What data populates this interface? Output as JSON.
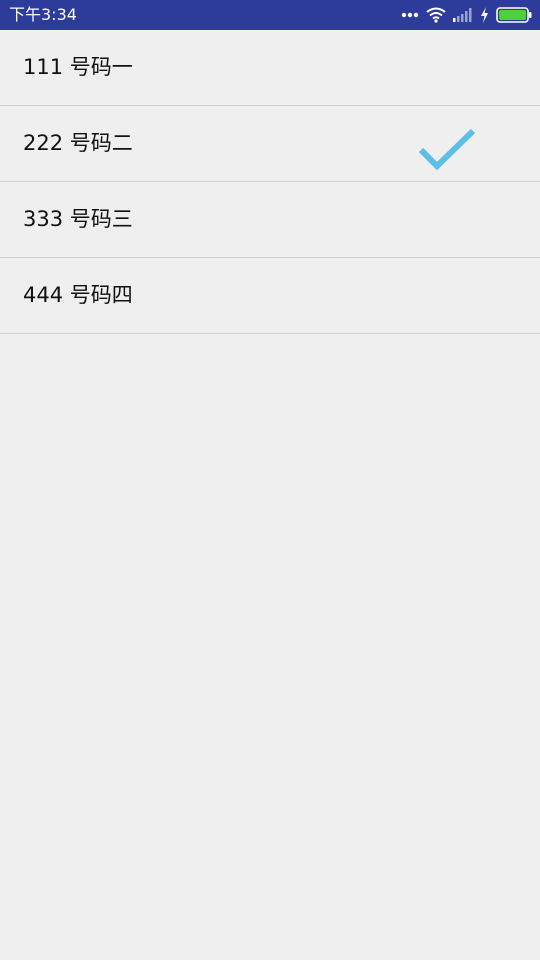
{
  "status_bar": {
    "time": "下午3:34",
    "background": "#2d3b9b",
    "icons": [
      "more-dots-icon",
      "wifi-icon",
      "signal-icon",
      "charging-icon",
      "battery-icon"
    ],
    "battery_color": "#4cd137"
  },
  "list": {
    "items": [
      {
        "label": "111 号码一",
        "selected": false
      },
      {
        "label": "222 号码二",
        "selected": true
      },
      {
        "label": "333 号码三",
        "selected": false
      },
      {
        "label": "444 号码四",
        "selected": false
      }
    ],
    "check_color": "#5bbfe8",
    "divider_color": "#cfcfcf"
  }
}
